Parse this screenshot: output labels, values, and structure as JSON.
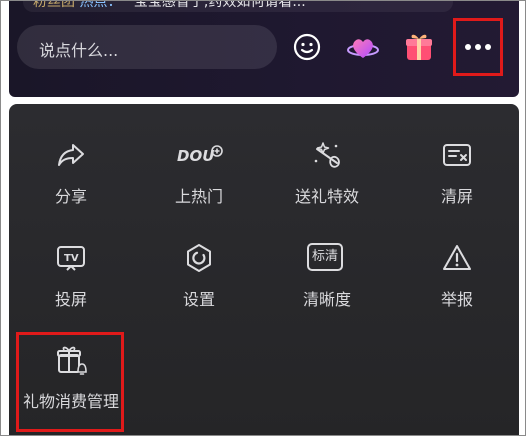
{
  "topbar": {
    "ticker_tag": "粉丝团",
    "ticker_tag2": "热点：",
    "ticker_text": "宝宝感冒了,药效如何请看...",
    "comment_placeholder": "说点什么...",
    "icons": [
      "smile-icon",
      "heart-planet-icon",
      "gift-box-icon"
    ],
    "more_icon": "more-dots-icon"
  },
  "panel": {
    "items": [
      {
        "label": "分享",
        "icon": "share-icon"
      },
      {
        "label": "上热门",
        "icon": "dou-plus-icon"
      },
      {
        "label": "送礼特效",
        "icon": "gift-effect-icon"
      },
      {
        "label": "清屏",
        "icon": "clear-screen-icon"
      },
      {
        "label": "投屏",
        "icon": "tv-cast-icon"
      },
      {
        "label": "设置",
        "icon": "settings-icon"
      },
      {
        "label": "清晰度",
        "icon": "resolution-icon"
      },
      {
        "label": "举报",
        "icon": "report-icon"
      },
      {
        "label": "礼物消费管理",
        "icon": "gift-spend-manage-icon"
      }
    ],
    "resolution_badge": "标清",
    "dou_text": "DOU"
  },
  "colors": {
    "panel_bg": "#2a2a2d",
    "highlight": "#e01a1a",
    "text": "#d9d9dc"
  }
}
